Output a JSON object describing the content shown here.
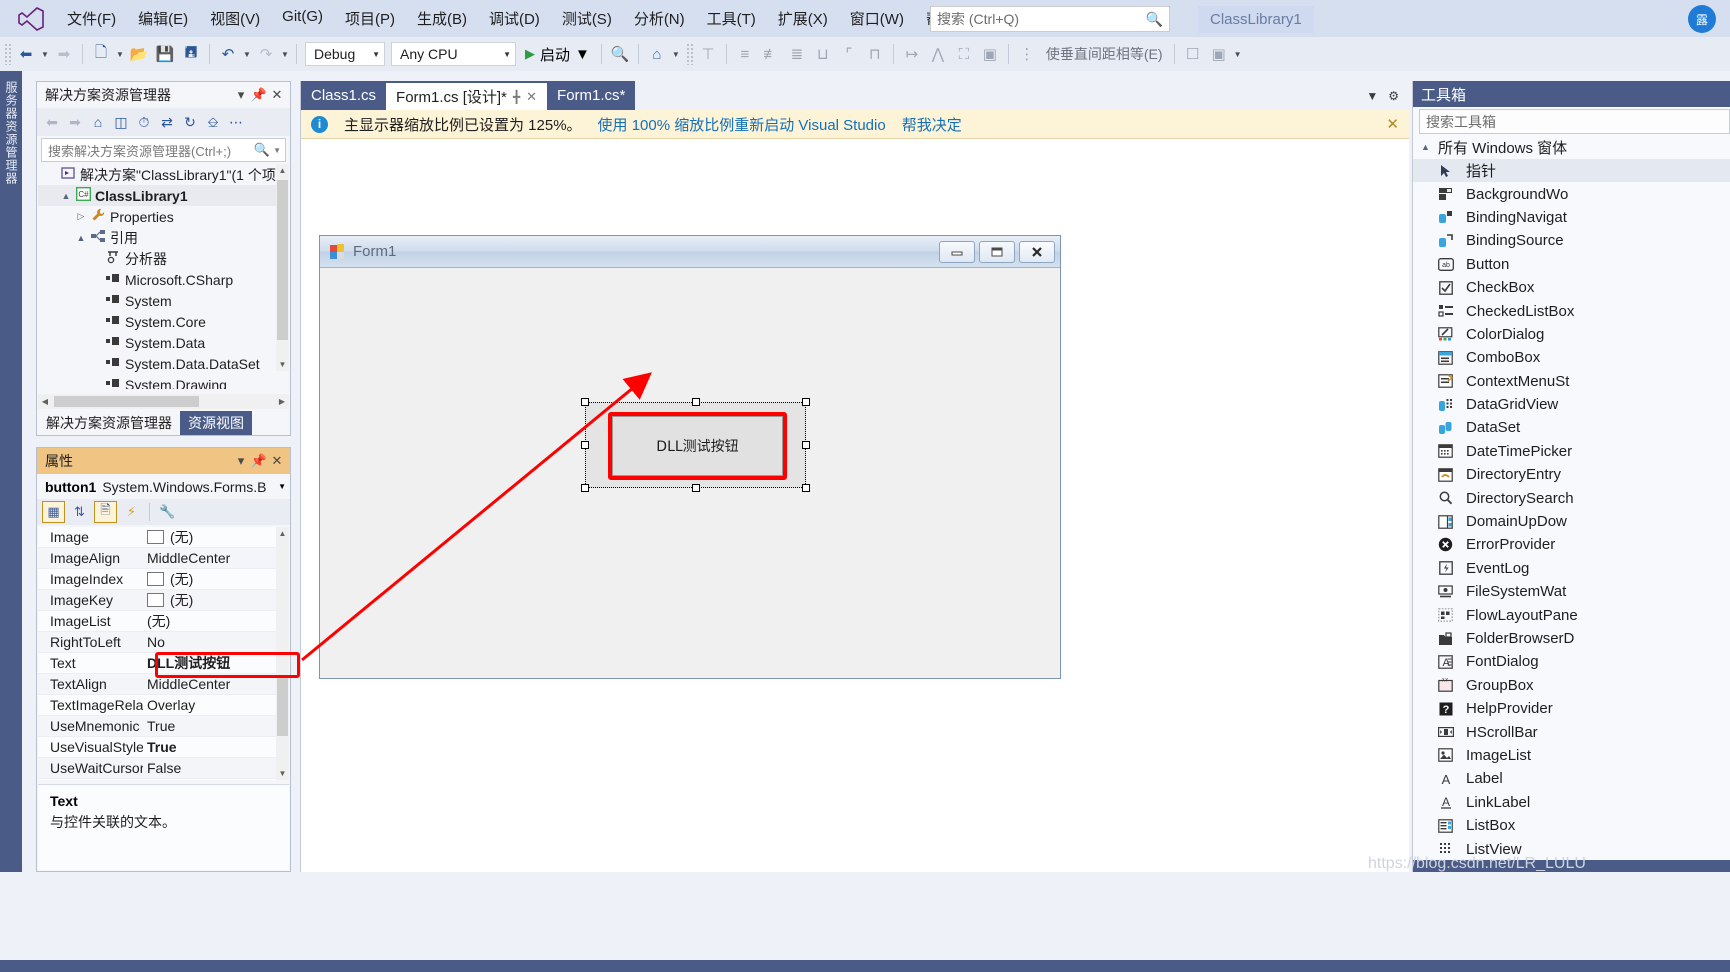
{
  "menubar": {
    "logo_icon": "visual-studio-logo",
    "items": [
      "文件(F)",
      "编辑(E)",
      "视图(V)",
      "Git(G)",
      "项目(P)",
      "生成(B)",
      "调试(D)",
      "测试(S)",
      "分析(N)",
      "工具(T)",
      "扩展(X)",
      "窗口(W)",
      "帮助(H)"
    ],
    "search_placeholder": "搜索 (Ctrl+Q)",
    "search_icon": "magnifier-icon",
    "solution_pill": "ClassLibrary1",
    "account_badge": "露"
  },
  "toolbar": {
    "back_icon": "navigate-back-icon",
    "forward_icon": "navigate-forward-icon",
    "new_icon": "new-item-icon",
    "open_icon": "open-folder-icon",
    "save_icon": "save-icon",
    "save_all_icon": "save-all-icon",
    "undo_icon": "undo-icon",
    "redo_icon": "redo-icon",
    "config_value": "Debug",
    "platform_value": "Any CPU",
    "run_label": "启动",
    "run_icon": "play-icon",
    "find_icon": "find-in-files-icon",
    "home_icon": "home-icon",
    "align_icons": [
      "align-top",
      "align-left",
      "align-center-h",
      "align-right",
      "align-tops",
      "align-middles",
      "align-bottoms",
      "make-same-width",
      "make-same-height",
      "make-same-size",
      "size-to-grid"
    ],
    "spacing_label": "使垂直间距相等(E)",
    "bring_front_icon": "bring-to-front-icon",
    "send_back_icon": "send-to-back-icon",
    "overflow_icon": "toolbar-overflow-icon"
  },
  "left_edge": {
    "vertical_label": "服务器资源管理器"
  },
  "solution_explorer": {
    "title": "解决方案资源管理器",
    "title_buttons": [
      "▾",
      "📌",
      "✕"
    ],
    "toolbar_icons": [
      "back-icon",
      "forward-icon",
      "home-icon",
      "sync-with-document-icon",
      "pending-changes-icon",
      "collapse-all-icon",
      "refresh-icon",
      "show-all-files-icon",
      "overflow-icon"
    ],
    "search_placeholder": "搜索解决方案资源管理器(Ctrl+;)",
    "search_icon": "magnifier-icon",
    "tree": [
      {
        "indent": 0,
        "twisty": "",
        "icon": "solution-icon",
        "label": "解决方案\"ClassLibrary1\"(1 个项",
        "bold": false,
        "selected": false
      },
      {
        "indent": 1,
        "twisty": "▲",
        "icon": "csharp-project-icon",
        "label": "ClassLibrary1",
        "bold": true,
        "selected": true
      },
      {
        "indent": 2,
        "twisty": "▷",
        "icon": "wrench-icon",
        "label": "Properties",
        "bold": false,
        "selected": false
      },
      {
        "indent": 2,
        "twisty": "▲",
        "icon": "references-icon",
        "label": "引用",
        "bold": false,
        "selected": false
      },
      {
        "indent": 3,
        "twisty": "",
        "icon": "analyzer-icon",
        "label": "分析器",
        "bold": false,
        "selected": false
      },
      {
        "indent": 3,
        "twisty": "",
        "icon": "reference-icon",
        "label": "Microsoft.CSharp",
        "bold": false,
        "selected": false
      },
      {
        "indent": 3,
        "twisty": "",
        "icon": "reference-icon",
        "label": "System",
        "bold": false,
        "selected": false
      },
      {
        "indent": 3,
        "twisty": "",
        "icon": "reference-icon",
        "label": "System.Core",
        "bold": false,
        "selected": false
      },
      {
        "indent": 3,
        "twisty": "",
        "icon": "reference-icon",
        "label": "System.Data",
        "bold": false,
        "selected": false
      },
      {
        "indent": 3,
        "twisty": "",
        "icon": "reference-icon",
        "label": "System.Data.DataSet",
        "bold": false,
        "selected": false
      },
      {
        "indent": 3,
        "twisty": "",
        "icon": "reference-icon",
        "label": "System.Drawing",
        "bold": false,
        "selected": false
      }
    ],
    "tabs": [
      {
        "label": "解决方案资源管理器",
        "active": true
      },
      {
        "label": "资源视图",
        "active": false
      }
    ]
  },
  "properties": {
    "title": "属性",
    "title_buttons": [
      "▾",
      "📌",
      "✕"
    ],
    "object_name": "button1",
    "object_type": "System.Windows.Forms.B",
    "toolbar_icons": [
      "categorized-icon",
      "alphabetical-icon",
      "properties-page-icon",
      "events-icon",
      "property-pages-icon"
    ],
    "rows": [
      {
        "name": "Image",
        "value": "(无)",
        "swatch": true,
        "bold": false,
        "highlight": false
      },
      {
        "name": "ImageAlign",
        "value": "MiddleCenter",
        "swatch": false,
        "bold": false,
        "highlight": false
      },
      {
        "name": "ImageIndex",
        "value": "(无)",
        "swatch": true,
        "bold": false,
        "highlight": false
      },
      {
        "name": "ImageKey",
        "value": "(无)",
        "swatch": true,
        "bold": false,
        "highlight": false
      },
      {
        "name": "ImageList",
        "value": "(无)",
        "swatch": false,
        "bold": false,
        "highlight": false
      },
      {
        "name": "RightToLeft",
        "value": "No",
        "swatch": false,
        "bold": false,
        "highlight": false
      },
      {
        "name": "Text",
        "value": "DLL测试按钮",
        "swatch": false,
        "bold": true,
        "highlight": true
      },
      {
        "name": "TextAlign",
        "value": "MiddleCenter",
        "swatch": false,
        "bold": false,
        "highlight": false
      },
      {
        "name": "TextImageRelat",
        "value": "Overlay",
        "swatch": false,
        "bold": false,
        "highlight": false
      },
      {
        "name": "UseMnemonic",
        "value": "True",
        "swatch": false,
        "bold": false,
        "highlight": false
      },
      {
        "name": "UseVisualStyleB",
        "value": "True",
        "swatch": false,
        "bold": true,
        "highlight": false
      },
      {
        "name": "UseWaitCursor",
        "value": "False",
        "swatch": false,
        "bold": false,
        "highlight": false
      }
    ],
    "description_title": "Text",
    "description_body": "与控件关联的文本。"
  },
  "editor": {
    "tabs": [
      {
        "label": "Class1.cs",
        "active": false,
        "pinned": false,
        "closable": false
      },
      {
        "label": "Form1.cs [设计]*",
        "active": true,
        "pinned": true,
        "closable": true
      },
      {
        "label": "Form1.cs*",
        "active": false,
        "pinned": false,
        "closable": false
      }
    ],
    "tabstrip_buttons": [
      "▾",
      "⚙"
    ],
    "notification": {
      "info_icon": "info-icon",
      "message": "主显示器缩放比例已设置为 125%。",
      "link_restart": "使用 100% 缩放比例重新启动 Visual Studio",
      "link_decide": "帮我决定",
      "close_icon": "close-icon"
    }
  },
  "form_designer": {
    "window_title": "Form1",
    "window_icon": "winform-icon",
    "minimize_icon": "minimize-icon",
    "maximize_icon": "maximize-icon",
    "close_icon": "close-icon",
    "selected_control": {
      "text": "DLL测试按钮",
      "type": "Button",
      "selected": true,
      "highlight_color": "#ff0000"
    }
  },
  "annotation": {
    "color": "#ff0000",
    "arrow_from": "properties-text-row",
    "arrow_to": "form-button"
  },
  "toolbox": {
    "title": "工具箱",
    "search_placeholder": "搜索工具箱",
    "group_label": "所有 Windows 窗体",
    "group_twisty": "▲",
    "items": [
      {
        "label": "指针",
        "icon": "pointer-icon",
        "glyph": "➤",
        "selected": true
      },
      {
        "label": "BackgroundWo",
        "icon": "backgroundworker-icon",
        "glyph": "▤",
        "selected": false
      },
      {
        "label": "BindingNavigat",
        "icon": "bindingnavigator-icon",
        "glyph": "▣",
        "selected": false
      },
      {
        "label": "BindingSource",
        "icon": "bindingsource-icon",
        "glyph": "◧",
        "selected": false
      },
      {
        "label": "Button",
        "icon": "button-icon",
        "glyph": "ab",
        "selected": false
      },
      {
        "label": "CheckBox",
        "icon": "checkbox-icon",
        "glyph": "☑",
        "selected": false
      },
      {
        "label": "CheckedListBox",
        "icon": "checkedlistbox-icon",
        "glyph": "☲",
        "selected": false
      },
      {
        "label": "ColorDialog",
        "icon": "colordialog-icon",
        "glyph": "◩",
        "selected": false
      },
      {
        "label": "ComboBox",
        "icon": "combobox-icon",
        "glyph": "▤",
        "selected": false
      },
      {
        "label": "ContextMenuSt",
        "icon": "contextmenustrip-icon",
        "glyph": "▥",
        "selected": false
      },
      {
        "label": "DataGridView",
        "icon": "datagridview-icon",
        "glyph": "▦",
        "selected": false
      },
      {
        "label": "DataSet",
        "icon": "dataset-icon",
        "glyph": "◨",
        "selected": false
      },
      {
        "label": "DateTimePicker",
        "icon": "datetimepicker-icon",
        "glyph": "▩",
        "selected": false
      },
      {
        "label": "DirectoryEntry",
        "icon": "directoryentry-icon",
        "glyph": "▧",
        "selected": false
      },
      {
        "label": "DirectorySearch",
        "icon": "directorysearcher-icon",
        "glyph": "🔍",
        "selected": false
      },
      {
        "label": "DomainUpDow",
        "icon": "domainupdown-icon",
        "glyph": "▫",
        "selected": false
      },
      {
        "label": "ErrorProvider",
        "icon": "errorprovider-icon",
        "glyph": "✖",
        "selected": false
      },
      {
        "label": "EventLog",
        "icon": "eventlog-icon",
        "glyph": "⚡",
        "selected": false
      },
      {
        "label": "FileSystemWat",
        "icon": "filesystemwatcher-icon",
        "glyph": "▨",
        "selected": false
      },
      {
        "label": "FlowLayoutPane",
        "icon": "flowlayoutpanel-icon",
        "glyph": "▪",
        "selected": false
      },
      {
        "label": "FolderBrowserD",
        "icon": "folderbrowserdialog-icon",
        "glyph": "▬",
        "selected": false
      },
      {
        "label": "FontDialog",
        "icon": "fontdialog-icon",
        "glyph": "A",
        "selected": false
      },
      {
        "label": "GroupBox",
        "icon": "groupbox-icon",
        "glyph": "▭",
        "selected": false
      },
      {
        "label": "HelpProvider",
        "icon": "helpprovider-icon",
        "glyph": "?",
        "selected": false
      },
      {
        "label": "HScrollBar",
        "icon": "hscrollbar-icon",
        "glyph": "◫",
        "selected": false
      },
      {
        "label": "ImageList",
        "icon": "imagelist-icon",
        "glyph": "▥",
        "selected": false
      },
      {
        "label": "Label",
        "icon": "label-icon",
        "glyph": "A",
        "selected": false
      },
      {
        "label": "LinkLabel",
        "icon": "linklabel-icon",
        "glyph": "A",
        "selected": false
      },
      {
        "label": "ListBox",
        "icon": "listbox-icon",
        "glyph": "▤",
        "selected": false
      },
      {
        "label": "ListView",
        "icon": "listview-icon",
        "glyph": "⠿",
        "selected": false
      }
    ]
  },
  "watermark": "https://blog.csdn.net/LR_LULU"
}
